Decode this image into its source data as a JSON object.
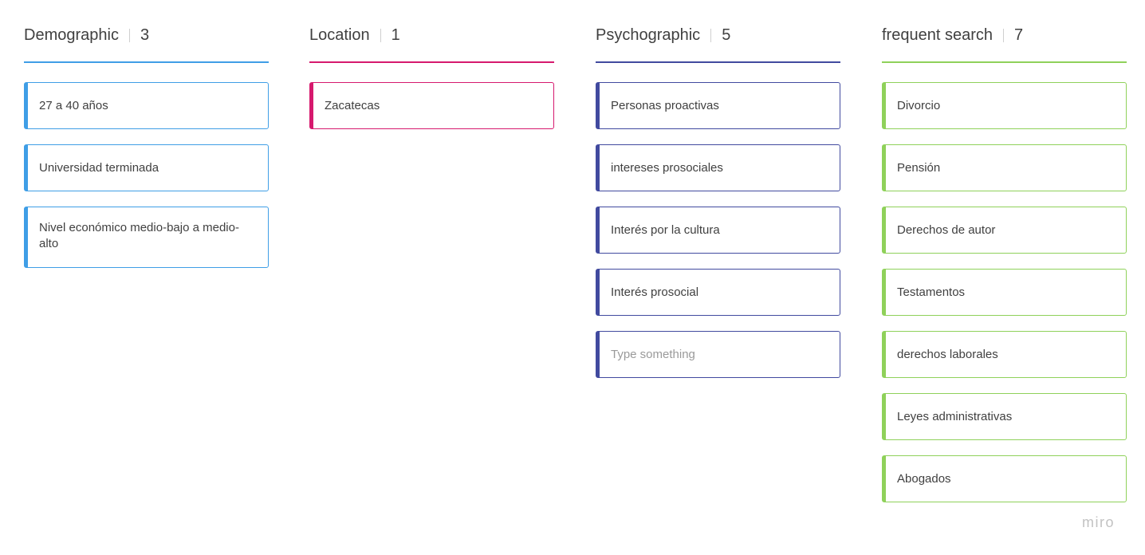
{
  "columns": [
    {
      "title": "Demographic",
      "count": "3",
      "color": "#3f9ee6",
      "cards": [
        {
          "text": "27 a 40 años"
        },
        {
          "text": "Universidad terminada"
        },
        {
          "text": "Nivel económico medio-bajo a medio-alto"
        }
      ]
    },
    {
      "title": "Location",
      "count": "1",
      "color": "#d6196e",
      "cards": [
        {
          "text": "Zacatecas"
        }
      ]
    },
    {
      "title": "Psychographic",
      "count": "5",
      "color": "#414a9f",
      "cards": [
        {
          "text": "Personas proactivas"
        },
        {
          "text": "intereses prosociales"
        },
        {
          "text": "Interés por la cultura"
        },
        {
          "text": "Interés prosocial"
        },
        {
          "text": "",
          "placeholder": "Type something"
        }
      ]
    },
    {
      "title": "frequent search",
      "count": "7",
      "color": "#8fd15a",
      "cards": [
        {
          "text": "Divorcio"
        },
        {
          "text": "Pensión"
        },
        {
          "text": "Derechos de autor"
        },
        {
          "text": "Testamentos"
        },
        {
          "text": "derechos laborales"
        },
        {
          "text": "Leyes administrativas"
        },
        {
          "text": "Abogados"
        }
      ]
    }
  ],
  "watermark": "miro"
}
